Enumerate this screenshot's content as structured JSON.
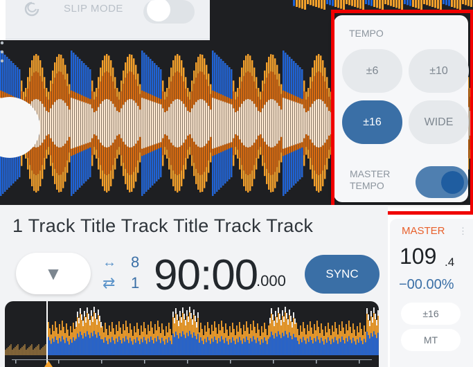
{
  "top": {
    "slip_mode_label": "SLIP MODE"
  },
  "tempo_popup": {
    "title": "TEMPO",
    "buttons": [
      "±6",
      "±10",
      "±16",
      "WIDE"
    ],
    "selected": "±16",
    "master_tempo_label_line1": "MASTER",
    "master_tempo_label_line2": "TEMPO",
    "master_tempo_on": true
  },
  "deck": {
    "track_title": "1 Track Title Track Title Track Track",
    "loop_beats": "8",
    "loop_count": "1",
    "time_main": "90:00",
    "time_ms": ".000",
    "sync_label": "SYNC"
  },
  "master_panel": {
    "label": "MASTER",
    "bpm": "109",
    "bpm_decimal": ".4",
    "pitch": "−00.00%",
    "tempo_range": "±16",
    "mt_label": "MT"
  },
  "colors": {
    "accent_blue": "#3a6fa6",
    "master_orange": "#e8602c",
    "highlight_red": "#f00000",
    "wave_orange": "#f5a12c",
    "wave_dark_orange": "#d96c12",
    "wave_blue": "#1e63d6",
    "wave_cream": "#fbe6cf"
  },
  "icons": {
    "slip": "slip-mode-icon",
    "cue": "triangle-down-icon",
    "loop_beat": "arrows-horizontal-icon",
    "loop_repeat": "repeat-icon"
  }
}
